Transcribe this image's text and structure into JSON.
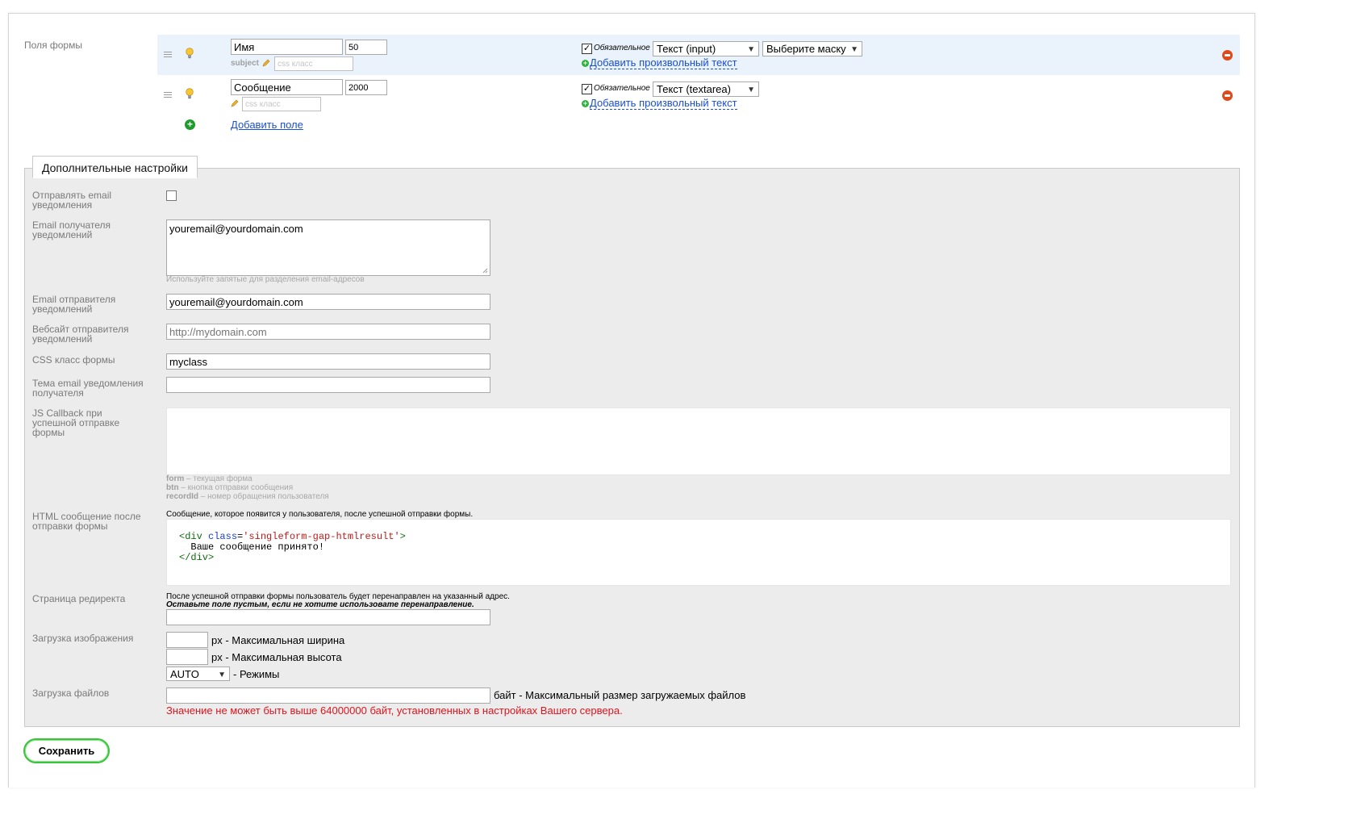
{
  "form_fields_section": {
    "label": "Поля формы",
    "fields": [
      {
        "name_value": "Имя",
        "size_value": "50",
        "subject_label": "subject",
        "css_placeholder": "css класс",
        "required_checked": true,
        "required_label": "Обязательное",
        "type_value": "Текст (input)",
        "mask_value": "Выберите маску",
        "add_custom_text_link": "Добавить произвольный текст"
      },
      {
        "name_value": "Сообщение",
        "size_value": "2000",
        "subject_label": "",
        "css_placeholder": "css класс",
        "required_checked": true,
        "required_label": "Обязательное",
        "type_value": "Текст (textarea)",
        "add_custom_text_link": "Добавить произвольный текст"
      }
    ],
    "add_field_link": "Добавить поле"
  },
  "additional_settings": {
    "legend": "Дополнительные настройки",
    "send_email_label": "Отправлять email уведомления",
    "send_email_checked": false,
    "recipient_label": "Email получателя уведомлений",
    "recipient_value": "youremail@yourdomain.com",
    "recipient_hint": "Используйте запятые для разделения email-адресов",
    "sender_label": "Email отправителя уведомлений",
    "sender_value": "youremail@yourdomain.com",
    "website_label": "Вебсайт отправителя уведомлений",
    "website_placeholder": "http://mydomain.com",
    "css_class_label": "CSS класс формы",
    "css_class_value": "myclass",
    "subject_label": "Тема email уведомления получателя",
    "subject_value": "",
    "js_callback_label": "JS Callback при успешной отправке формы",
    "js_hints": [
      {
        "key": "form",
        "text": " – текущая форма"
      },
      {
        "key": "btn",
        "text": " – кнопка отправки сообщения"
      },
      {
        "key": "recordId",
        "text": " – номер обращения пользователя"
      }
    ],
    "html_message_label": "HTML сообщение после отправки формы",
    "html_message_hint": "Сообщение, которое появится у пользователя, после успешной отправки формы.",
    "html_code": {
      "open_tag": "<div",
      "attr": "class",
      "eq": "=",
      "value": "'singleform-gap-htmlresult'",
      "close_bracket": ">",
      "body": "Ваше сообщение принято!",
      "end_tag": "</div>"
    },
    "redirect_label": "Страница редиректа",
    "redirect_hint_1": "После успешной отправки формы пользователь будет перенаправлен на указанный адрес.",
    "redirect_hint_2": "Оставьте поле пустым, если не хотите использовате перенаправление.",
    "image_upload_label": "Загрузка изображения",
    "max_width_label": "px - Максимальная ширина",
    "max_height_label": "px - Максимальная высота",
    "mode_value": "AUTO",
    "mode_label": "- Режимы",
    "file_upload_label": "Загрузка файлов",
    "file_size_label": "байт - Максимальный размер загружаемых файлов",
    "file_size_error": "Значение не может быть выше 64000000 байт, установленных в настройках Вашего сервера."
  },
  "save_button": "Сохранить"
}
